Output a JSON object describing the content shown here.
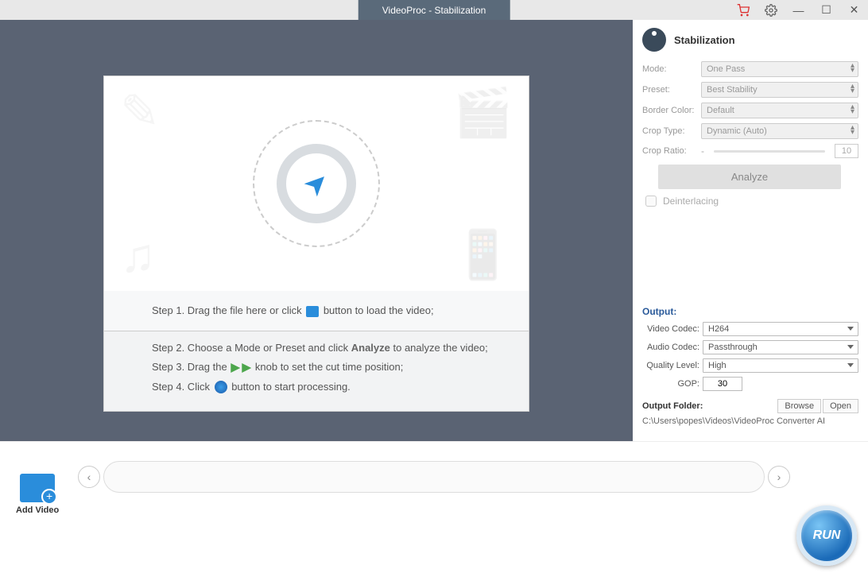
{
  "titlebar": {
    "title": "VideoProc - Stabilization"
  },
  "steps": {
    "s1a": "Step 1. Drag the file here or click ",
    "s1b": " button to load the video;",
    "s2a": "Step 2. Choose a Mode or Preset and click ",
    "s2analyze": "Analyze",
    "s2b": " to analyze the video;",
    "s3a": "Step 3. Drag the ",
    "s3b": " knob to set the cut time position;",
    "s4a": "Step 4. Click ",
    "s4b": " button to start processing."
  },
  "stab": {
    "title": "Stabilization",
    "mode_l": "Mode:",
    "mode_v": "One Pass",
    "preset_l": "Preset:",
    "preset_v": "Best Stability",
    "border_l": "Border Color:",
    "border_v": "Default",
    "crop_l": "Crop Type:",
    "crop_v": "Dynamic (Auto)",
    "ratio_l": "Crop Ratio:",
    "ratio_v": "10",
    "analyze_btn": "Analyze",
    "deint": "Deinterlacing"
  },
  "output": {
    "title": "Output:",
    "vcodec_l": "Video Codec:",
    "vcodec_v": "H264",
    "acodec_l": "Audio Codec:",
    "acodec_v": "Passthrough",
    "qual_l": "Quality Level:",
    "qual_v": "High",
    "gop_l": "GOP:",
    "gop_v": "30",
    "folder_l": "Output Folder:",
    "browse": "Browse",
    "open": "Open",
    "path": "C:\\Users\\popes\\Videos\\VideoProc Converter AI"
  },
  "bottom": {
    "add": "Add Video",
    "run": "RUN"
  }
}
